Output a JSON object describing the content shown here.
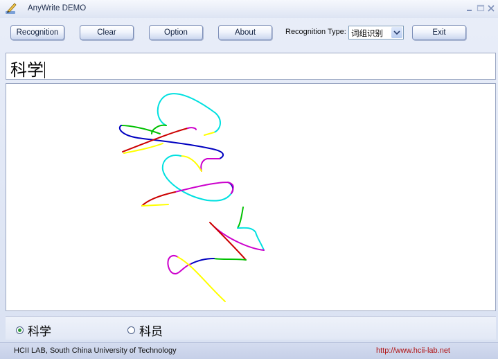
{
  "window": {
    "title": "AnyWrite DEMO"
  },
  "toolbar": {
    "recognition_label": "Recognition",
    "clear_label": "Clear",
    "option_label": "Option",
    "about_label": "About",
    "recognition_type_label": "Recognition Type:",
    "recognition_type_value": "词组识别",
    "exit_label": "Exit"
  },
  "result": {
    "text": "科学"
  },
  "candidates": [
    {
      "text": "科学",
      "selected": true
    },
    {
      "text": "科员",
      "selected": false
    }
  ],
  "status": {
    "lab": "HCII LAB, South China University of Technology",
    "url": "http://www.hcii-lab.net"
  },
  "stroke_colors": [
    "#00e0e0",
    "#00c000",
    "#ffff00",
    "#cc0000",
    "#0000c0",
    "#cc00cc"
  ]
}
